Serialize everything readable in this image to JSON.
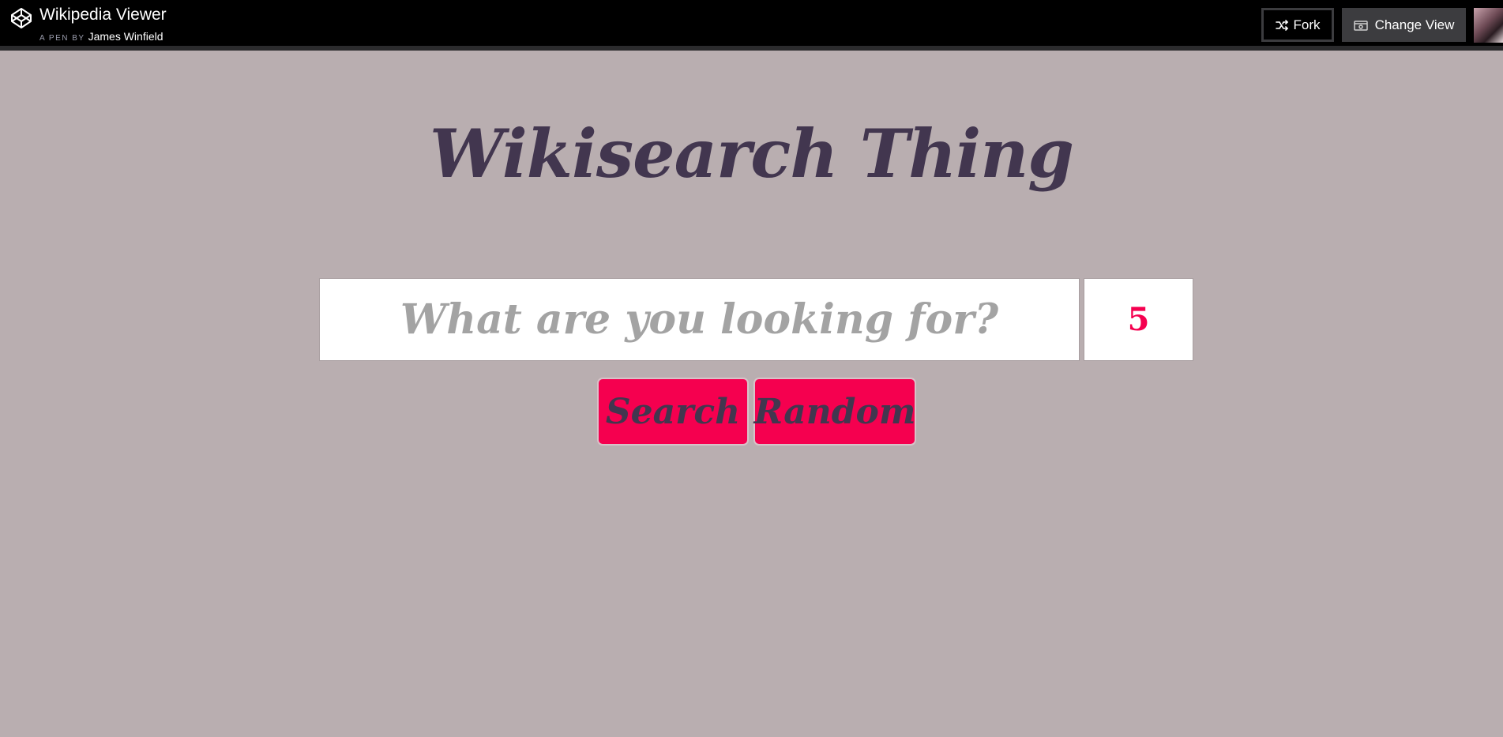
{
  "header": {
    "pen_title": "Wikipedia Viewer",
    "byline_prefix": "A PEN BY",
    "author": "James Winfield",
    "fork_label": "Fork",
    "change_view_label": "Change View"
  },
  "main": {
    "title": "Wikisearch Thing",
    "search_placeholder": "What are you looking for?",
    "search_value": "",
    "count_value": "5",
    "search_button": "Search",
    "random_button": "Random"
  },
  "colors": {
    "background": "#b9aeb0",
    "title": "#42364f",
    "accent": "#f5004f",
    "topbar": "#000000"
  },
  "icons": {
    "logo": "codepen-logo-icon",
    "fork": "fork-icon",
    "change_view": "change-view-icon"
  }
}
